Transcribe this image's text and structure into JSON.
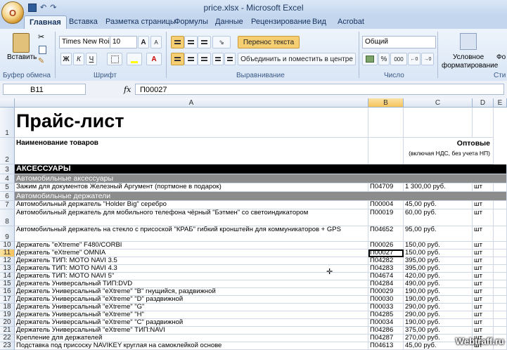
{
  "window": {
    "title": "price.xlsx - Microsoft Excel",
    "office_button": "O"
  },
  "qat": {
    "save_icon": "save-icon",
    "undo": "↶",
    "redo": "↷"
  },
  "tabs": [
    "Главная",
    "Вставка",
    "Разметка страницы",
    "Формулы",
    "Данные",
    "Рецензирование",
    "Вид",
    "Acrobat"
  ],
  "ribbon": {
    "paste_label": "Вставить",
    "clipboard_group": "Буфер обмена",
    "font_name": "Times New Roi",
    "font_size": "10",
    "font_group": "Шрифт",
    "wrap_text": "Перенос текста",
    "merge_center": "Объединить и поместить в центре",
    "alignment_group": "Выравнивание",
    "number_format": "Общий",
    "number_group": "Число",
    "cond_format_line1": "Условное",
    "cond_format_line2": "форматирование",
    "styles_group": "Сти",
    "grow_font": "A",
    "shrink_font": "A",
    "bold": "Ж",
    "italic": "К",
    "underline": "Ч",
    "percent": "%",
    "thousands": "000",
    "font_color": "A",
    "cut": "✂",
    "format_painter": "✎",
    "fo_partial": "Фо"
  },
  "formula_bar": {
    "name_box": "B11",
    "fx": "fx",
    "content": "П00027"
  },
  "columns": [
    "A",
    "B",
    "C",
    "D",
    "E"
  ],
  "sheet": {
    "title": "Прайс-лист",
    "header_name": "Наименование товаров",
    "header_wholesale": "Оптовые",
    "header_wholesale_note": "(включая НДС, без учета НП)",
    "section_accessories": "АКСЕССУАРЫ",
    "sub_auto_accessories": "Автомобильные аксессуары",
    "sub_auto_holders": "Автомобильные держатели",
    "rows": [
      {
        "num": "5",
        "name": "Зажим для документов Железный Аргумент (портмоне в подарок)",
        "code": "П04709",
        "price": "1 300,00 руб.",
        "unit": "шт"
      },
      {
        "num": "7",
        "name": "Автомобильный держатель \"Holder Big\" серебро",
        "code": "П00004",
        "price": "45,00 руб.",
        "unit": "шт"
      },
      {
        "num": "8",
        "name": "Автомобильный держатель для мобильного телефона чёрный \"Бэтмен\" со светоиндикатором",
        "code": "П00019",
        "price": "60,00 руб.",
        "unit": "шт"
      },
      {
        "num": "9",
        "name": "Автомобильный держатель на стекло с присоской \"КРАБ\" гибкий кронштейн  для коммуникаторов + GPS",
        "code": "П04652",
        "price": "95,00 руб.",
        "unit": "шт"
      },
      {
        "num": "10",
        "name": "Держатель  \"eXtreme\" F480/CORBI",
        "code": "П00026",
        "price": "150,00 руб.",
        "unit": "шт"
      },
      {
        "num": "11",
        "name": "Держатель  \"eXtreme\" OMNIA",
        "code": "П00027",
        "price": "150,00 руб.",
        "unit": "шт"
      },
      {
        "num": "12",
        "name": "Держатель ТИП: MOTO NAVI 3.5",
        "code": "П04282",
        "price": "395,00 руб.",
        "unit": "шт"
      },
      {
        "num": "13",
        "name": "Держатель ТИП: MOTO NAVI 4.3",
        "code": "П04283",
        "price": "395,00 руб.",
        "unit": "шт"
      },
      {
        "num": "14",
        "name": "Держатель ТИП: MOTO NAVI 5\"",
        "code": "П04674",
        "price": "420,00 руб.",
        "unit": "шт"
      },
      {
        "num": "15",
        "name": "Держатель Универсальный  ТИП:DVD",
        "code": "П04284",
        "price": "490,00 руб.",
        "unit": "шт"
      },
      {
        "num": "16",
        "name": "Держатель Универсальный \"eXtreme\" \"B\" гнущийся, раздвижной",
        "code": "П00029",
        "price": "190,00 руб.",
        "unit": "шт"
      },
      {
        "num": "17",
        "name": "Держатель Универсальный \"eXtreme\" \"D\"  раздвижной",
        "code": "П00030",
        "price": "190,00 руб.",
        "unit": "шт"
      },
      {
        "num": "18",
        "name": "Держатель Универсальный \"eXtreme\" \"G\"",
        "code": "П00033",
        "price": "290,00 руб.",
        "unit": "шт"
      },
      {
        "num": "19",
        "name": "Держатель Универсальный \"eXtreme\" \"H\"",
        "code": "П04285",
        "price": "290,00 руб.",
        "unit": "шт"
      },
      {
        "num": "20",
        "name": "Держатель Универсальный \"eXtreme\" \"С\" раздвижной",
        "code": "П00034",
        "price": "190,00 руб.",
        "unit": "шт"
      },
      {
        "num": "21",
        "name": "Держатель Универсальный \"eXtreme\" ТИП:NAVI",
        "code": "П04286",
        "price": "375,00 руб.",
        "unit": "шт"
      },
      {
        "num": "22",
        "name": "Крепление для держателей",
        "code": "П04287",
        "price": "270,00 руб.",
        "unit": "шт"
      },
      {
        "num": "23",
        "name": "Подставка под присоску NAVIKEY круглая на самоклейкой основе",
        "code": "П04613",
        "price": "45,00 руб.",
        "unit": "шт"
      }
    ],
    "row_labels": {
      "r1": "1",
      "r2": "2",
      "r3": "3",
      "r4": "4",
      "r6": "6"
    }
  },
  "watermark": "Webtraff.ru",
  "colors": {
    "section_black": "#000000",
    "subsection_gray": "#8c8c8c",
    "selection": "#f6c25b"
  }
}
